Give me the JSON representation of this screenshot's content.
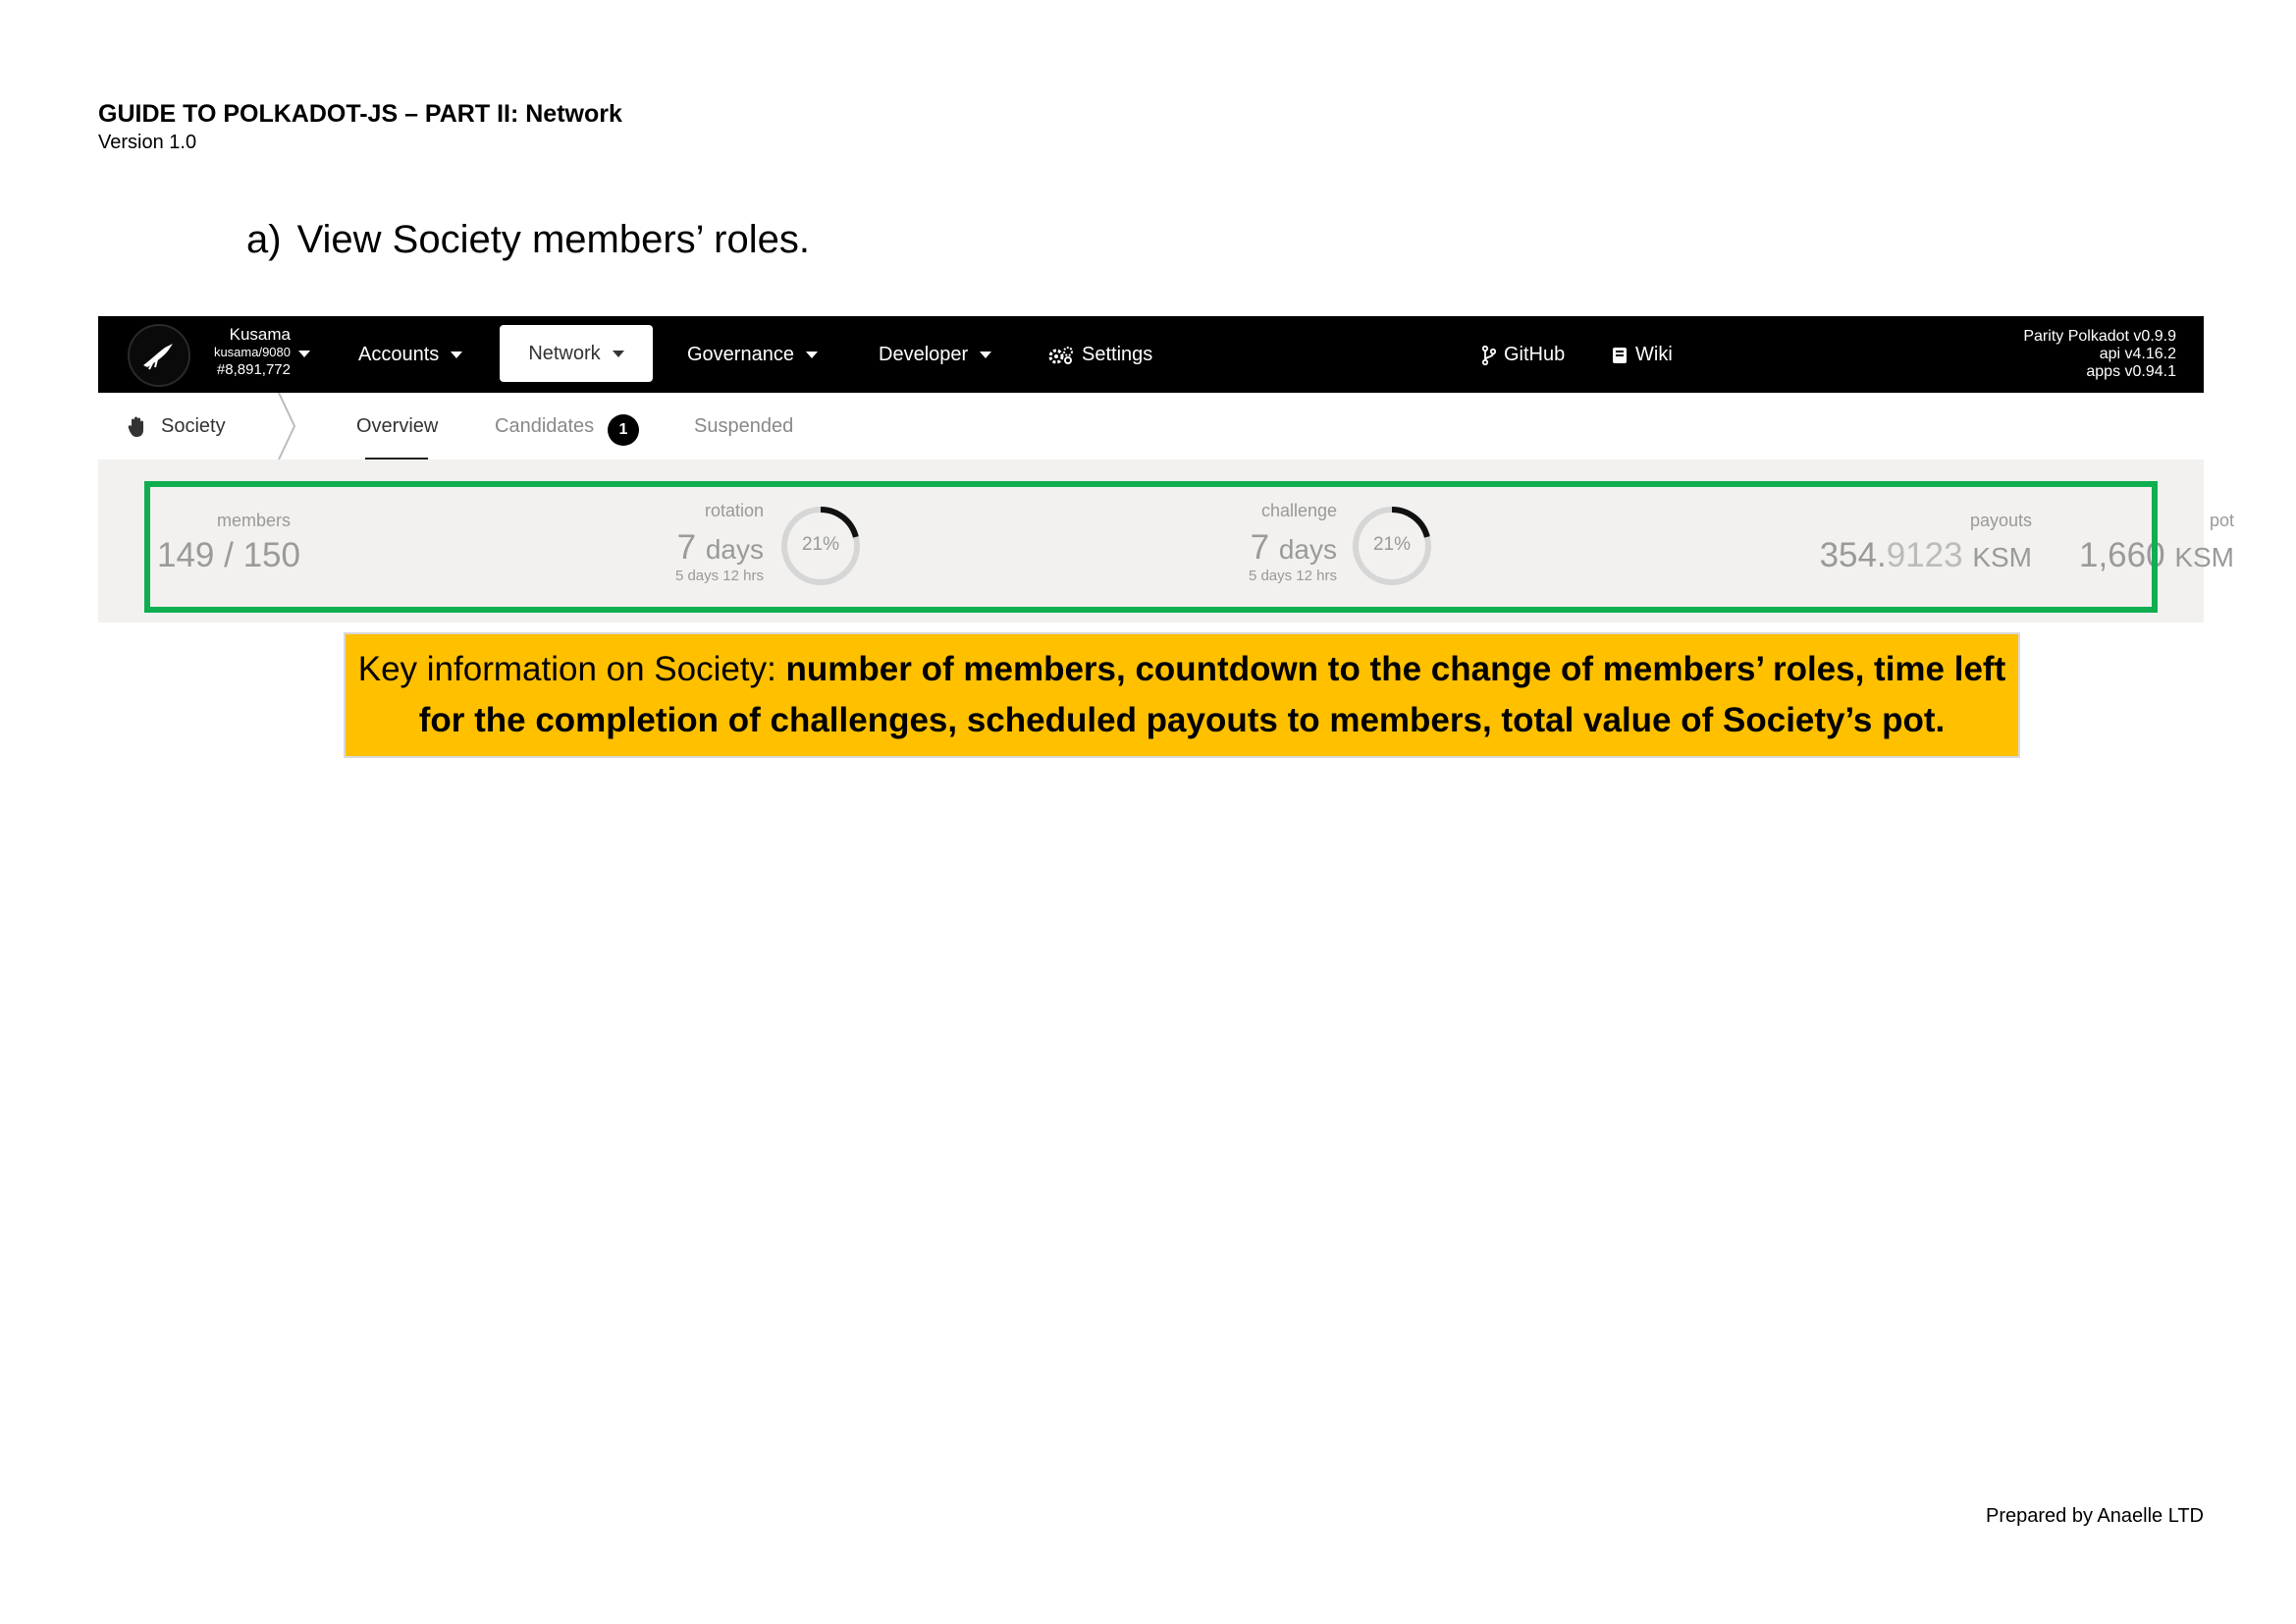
{
  "document": {
    "title": "GUIDE TO POLKADOT-JS – PART II: Network",
    "version": "Version 1.0",
    "section_number": "a)",
    "section_heading": "View Society members’ roles.",
    "footer": "Prepared by Anaelle LTD"
  },
  "app": {
    "chain": {
      "name": "Kusama",
      "endpoint": "kusama/9080",
      "block": "#8,891,772"
    },
    "nav": {
      "accounts": "Accounts",
      "network": "Network",
      "governance": "Governance",
      "developer": "Developer",
      "settings": "Settings",
      "github": "GitHub",
      "wiki": "Wiki"
    },
    "versions": {
      "node": "Parity Polkadot v0.9.9",
      "api": "api v4.16.2",
      "apps": "apps v0.94.1"
    },
    "subnav": {
      "section": "Society",
      "tabs": {
        "overview": "Overview",
        "candidates": "Candidates",
        "suspended": "Suspended"
      },
      "candidates_count": "1"
    },
    "summary": {
      "members": {
        "label": "members",
        "value": "149 / 150"
      },
      "rotation": {
        "label": "rotation",
        "value_num": "7",
        "value_unit": "days",
        "remaining": "5 days 12 hrs",
        "percent_text": "21%",
        "percent": 0.21
      },
      "challenge": {
        "label": "challenge",
        "value_num": "7",
        "value_unit": "days",
        "remaining": "5 days 12 hrs",
        "percent_text": "21%",
        "percent": 0.21
      },
      "payouts": {
        "label": "payouts",
        "value_int": "354.",
        "value_dec": "9123",
        "unit": "KSM"
      },
      "pot": {
        "label": "pot",
        "value": "1,660",
        "unit": "KSM"
      }
    }
  },
  "callout": {
    "lead": "Key information on Society: ",
    "bold": "number of members, countdown to the change of members’ roles, time left for the completion of challenges, scheduled payouts to members, total value of Society’s pot."
  },
  "colors": {
    "highlight_border": "#0fae50",
    "callout_bg": "#ffc000",
    "topbar_bg": "#000000"
  }
}
